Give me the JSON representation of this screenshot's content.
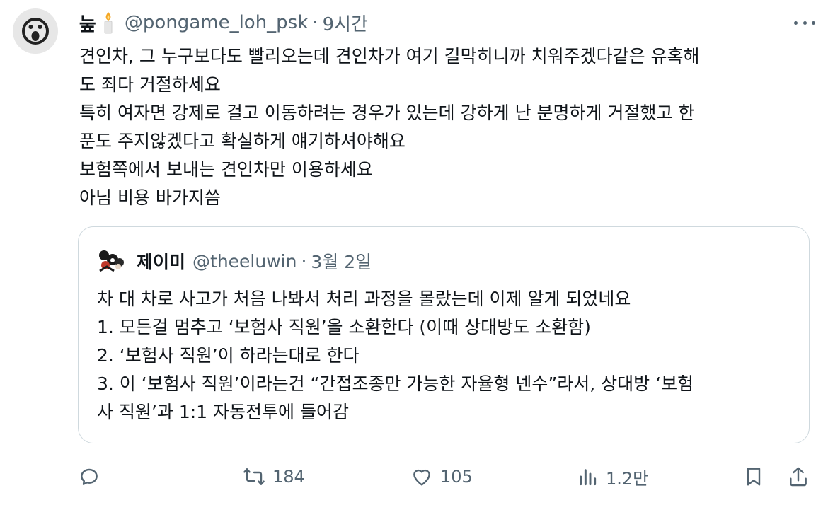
{
  "tweet": {
    "author_name": "눞",
    "author_handle": "@pongame_loh_psk",
    "separator": "·",
    "time": "9시간",
    "text": "견인차, 그 누구보다도 빨리오는데 견인차가 여기 길막히니까 치워주겠다같은 유혹해\n도 죄다 거절하세요\n특히 여자면 강제로 걸고 이동하려는 경우가 있는데 강하게 난 분명하게 거절했고 한\n푼도 주지않겠다고 확실하게 얘기하셔야해요\n보험쪽에서 보내는 견인차만 이용하세요\n아님 비용 바가지씀"
  },
  "quote": {
    "author_name": "제이미",
    "author_handle": "@theeluwin",
    "separator": "·",
    "time": "3월 2일",
    "text": "차 대 차로 사고가 처음 나봐서 처리 과정을 몰랐는데 이제 알게 되었네요\n1. 모든걸 멈추고 ‘보험사 직원’을 소환한다 (이때 상대방도 소환함)\n2. ‘보험사 직원’이 하라는대로 한다\n3. 이 ‘보험사 직원’이라는건 “간접조종만 가능한 자율형 넨수”라서, 상대방 ‘보험\n사 직원’과 1:1 자동전투에 들어감"
  },
  "actions": {
    "reply_icon": "reply-icon",
    "retweet_icon": "retweet-icon",
    "retweets": "184",
    "like_icon": "heart-icon",
    "likes": "105",
    "views_icon": "views-icon",
    "views": "1.2만",
    "bookmark_icon": "bookmark-icon",
    "share_icon": "share-icon"
  },
  "colors": {
    "text": "#0f1419",
    "secondary": "#536471",
    "border": "#cfd9de"
  }
}
